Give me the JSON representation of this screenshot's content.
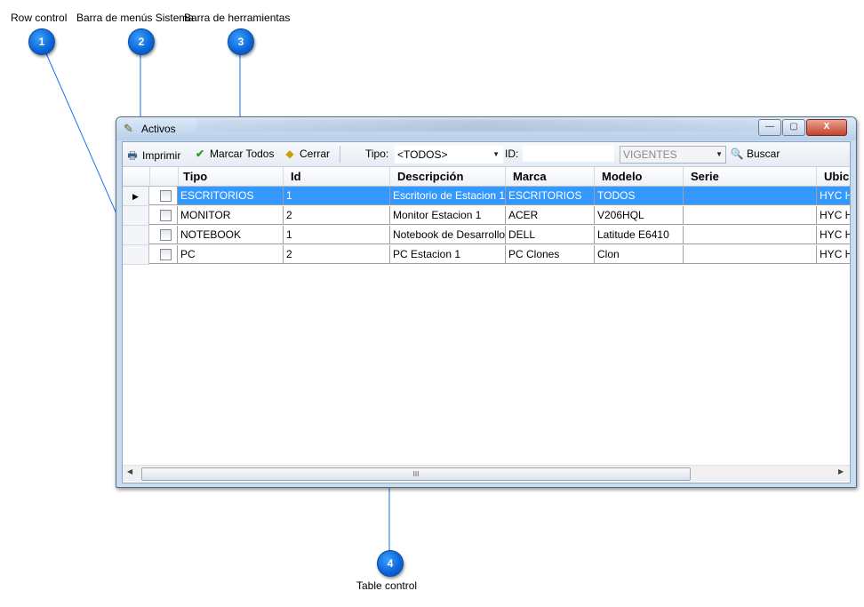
{
  "annotations": [
    {
      "num": "1",
      "label": "Row control"
    },
    {
      "num": "2",
      "label": "Barra de menús Sistema"
    },
    {
      "num": "3",
      "label": "Barra de herramientas"
    },
    {
      "num": "4",
      "label": "Table control"
    }
  ],
  "window": {
    "title": "Activos",
    "minimize_glyph": "—",
    "maximize_glyph": "▢",
    "close_glyph": "X"
  },
  "toolbar": {
    "print_label": "Imprimir",
    "mark_all_label": "Marcar Todos",
    "close_label": "Cerrar",
    "tipo_label": "Tipo:",
    "tipo_value": "<TODOS>",
    "id_label": "ID:",
    "id_value": "",
    "status_value": "VIGENTES",
    "search_label": "Buscar"
  },
  "table": {
    "columns": [
      "Tipo",
      "Id",
      "Descripción",
      "Marca",
      "Modelo",
      "Serie",
      "Ubic"
    ],
    "rows": [
      {
        "tipo": "ESCRITORIOS",
        "id": "1",
        "descripcion": "Escritorio de Estacion 1",
        "marca": "ESCRITORIOS",
        "modelo": "TODOS",
        "serie": "",
        "ubic": "HYC H",
        "selected": true
      },
      {
        "tipo": "MONITOR",
        "id": "2",
        "descripcion": "Monitor Estacion 1",
        "marca": "ACER",
        "modelo": "V206HQL",
        "serie": "",
        "ubic": "HYC H",
        "selected": false
      },
      {
        "tipo": "NOTEBOOK",
        "id": "1",
        "descripcion": "Notebook de Desarrollo",
        "marca": "DELL",
        "modelo": "Latitude E6410",
        "serie": "",
        "ubic": "HYC H",
        "selected": false
      },
      {
        "tipo": "PC",
        "id": "2",
        "descripcion": "PC Estacion 1",
        "marca": "PC Clones",
        "modelo": "Clon",
        "serie": "",
        "ubic": "HYC H",
        "selected": false
      }
    ],
    "current_row_glyph": "▶",
    "scroll_thumb_glyph": "III",
    "scroll_left_glyph": "◀",
    "scroll_right_glyph": "▶"
  },
  "colors": {
    "marker": "#0a63d6",
    "selection": "#3399ff",
    "window_frame": "#c9dcf0"
  }
}
